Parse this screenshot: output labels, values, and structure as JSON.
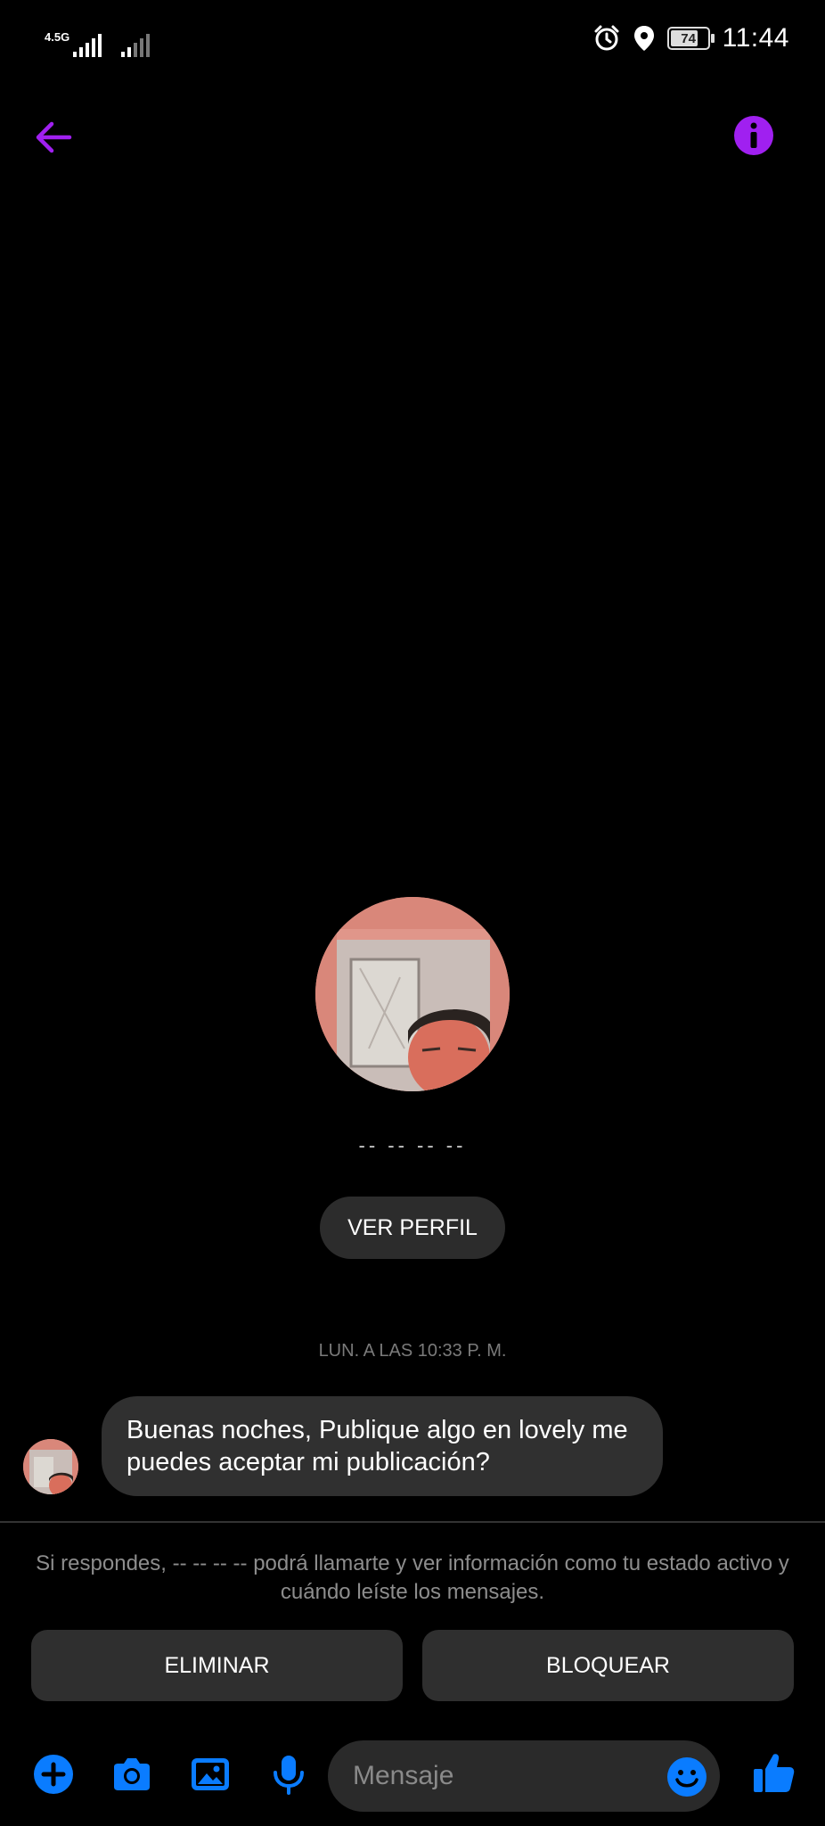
{
  "status_bar": {
    "network_label": "4.5G",
    "battery_level": "74",
    "time": "11:44"
  },
  "colors": {
    "accent_purple": "#a020f0",
    "accent_blue": "#0a7cff",
    "bubble_bg": "#303030",
    "button_bg": "#2f2f2f"
  },
  "header": {
    "back_icon": "arrow-left-icon",
    "info_icon": "info-icon"
  },
  "profile": {
    "name": "-- -- -- --",
    "view_profile_label": "VER PERFIL"
  },
  "conversation": {
    "timestamp": "LUN. A LAS 10:33 P. M.",
    "messages": [
      {
        "text": "Buenas noches, Publique algo en lovely me puedes aceptar mi publicación?"
      }
    ]
  },
  "request": {
    "notice": "Si respondes, -- -- -- -- podrá llamarte y ver información como tu estado activo y cuándo leíste los mensajes.",
    "delete_label": "ELIMINAR",
    "block_label": "BLOQUEAR"
  },
  "composer": {
    "placeholder": "Mensaje",
    "icons": [
      "plus-circle-icon",
      "camera-icon",
      "gallery-icon",
      "microphone-icon",
      "emoji-icon",
      "thumbs-up-icon"
    ]
  }
}
